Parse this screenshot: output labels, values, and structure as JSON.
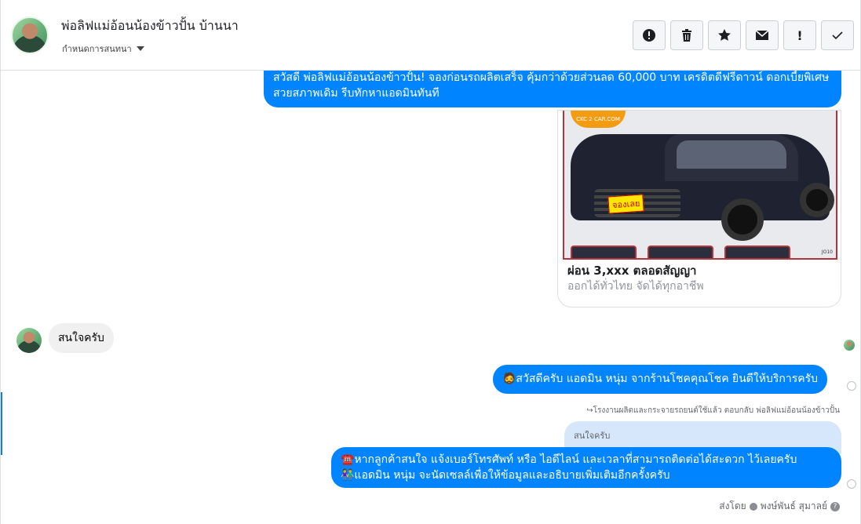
{
  "header": {
    "title": "พ่อลิฟแม่อ้อนน้องข้าวปั้น บ้านนา",
    "assign_label": "กำหนดการสนทนา",
    "tools": [
      {
        "icon": "alert-icon",
        "label": ""
      },
      {
        "icon": "trash-icon",
        "label": ""
      },
      {
        "icon": "star-icon",
        "label": ""
      },
      {
        "icon": "mail-icon",
        "label": ""
      },
      {
        "icon": "exclamation-icon",
        "label": "!"
      },
      {
        "icon": "check-icon",
        "label": ""
      }
    ]
  },
  "messages": {
    "promo": {
      "text": "สวัสดี พ่อลิฟแม่อ้อนน้องข้าวปั้น! จองก่อนรถผลิตเสร็จ คุ้มกว่าด้วยส่วนลด 60,000 บาท เครดิตดีฟรีดาวน์ ดอกเบี้ยพิเศษ สวยสภาพเดิม รีบทักหาแอดมินทันที",
      "card_logo": "CKC 2 CAR.COM",
      "card_tag": "จองเลย",
      "card_watermark": "JO10",
      "card_title": "ผ่อน 3,xxx ตลอดสัญญา",
      "card_subtitle": "ออกได้ทั่วไทย จัดได้ทุกอาชีพ"
    },
    "customer": {
      "text": "สนใจครับ"
    },
    "greeting": {
      "text": "🧔สวัสดีครับ แอดมิน หนุ่ม จากร้านโชคคุณโชค ยินดีให้บริการครับ"
    },
    "reply_note": "↪โรงงานผลิตและกระจายรถยนต์ใช้แล้ว ตอบกลับ พ่อลิฟแม่อ้อนน้องข้าวปั้น",
    "quoted": "สนใจครับ",
    "followup": {
      "line1": "☎️หากลูกค้าสนใจ แจ้งเบอร์โทรศัพท์ หรือ ไอดีไลน์ และเวลาที่สามารถติดต่อได้สะดวก ไว้เลยครับ",
      "line2": "👫แอดมิน หนุ่ม จะนัดเซลล์เพื่อให้ข้อมูลและอธิบายเพิ่มเติมอีกครั้งครับ"
    },
    "sent_by_prefix": "ส่งโดย",
    "sent_by_name": "พงษ์พันธ์ สุมาลย์",
    "help_mark": "?"
  },
  "colors": {
    "outgoing": "#0084ff",
    "incoming": "#f0f0f0",
    "quote_bg": "#d6e6fb"
  }
}
